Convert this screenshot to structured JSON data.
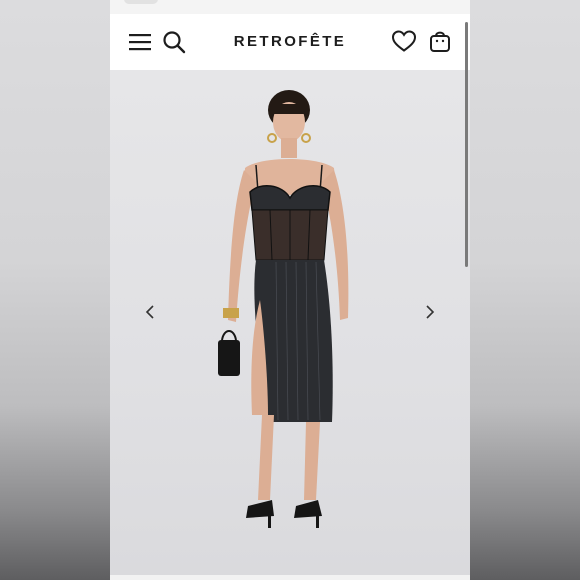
{
  "header": {
    "brand": "RETROFÊTE",
    "icons": {
      "menu": "hamburger-menu-icon",
      "search": "search-icon",
      "wishlist": "heart-icon",
      "bag": "shopping-bag-icon"
    }
  },
  "gallery": {
    "image_subject": "product-photo-model-pinstripe-lace-corset-midi-dress",
    "prev_icon": "chevron-left-icon",
    "next_icon": "chevron-right-icon"
  },
  "colors": {
    "header_bg": "#ffffff",
    "brand_text": "#1d1d1d",
    "gallery_bg": "#e3e3e6",
    "dress": "#2b2d31"
  }
}
